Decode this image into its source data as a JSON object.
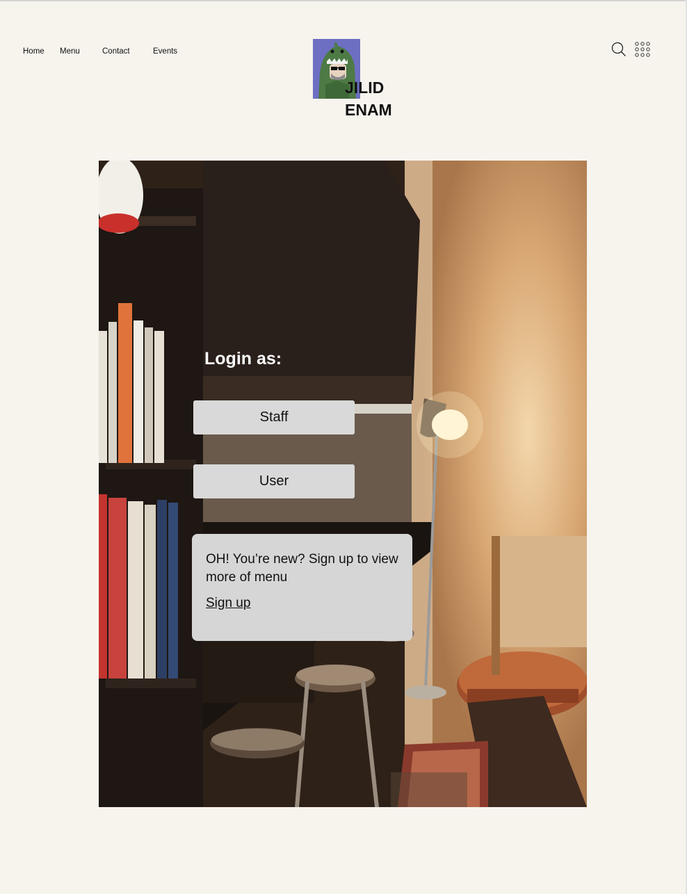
{
  "nav": {
    "items": [
      {
        "label": "Home"
      },
      {
        "label": "Menu"
      },
      {
        "label": "Contact"
      },
      {
        "label": "Events"
      }
    ]
  },
  "brand": {
    "line1": "JILID",
    "line2": "ENAM",
    "logo_bg": "#6d6fc2"
  },
  "header_icons": [
    "search-icon",
    "grid-menu-icon"
  ],
  "login": {
    "title": "Login as:",
    "staff_label": "Staff",
    "user_label": "User"
  },
  "signup": {
    "message": "OH! You’re new? Sign up to view more of menu",
    "link_label": "Sign up"
  }
}
